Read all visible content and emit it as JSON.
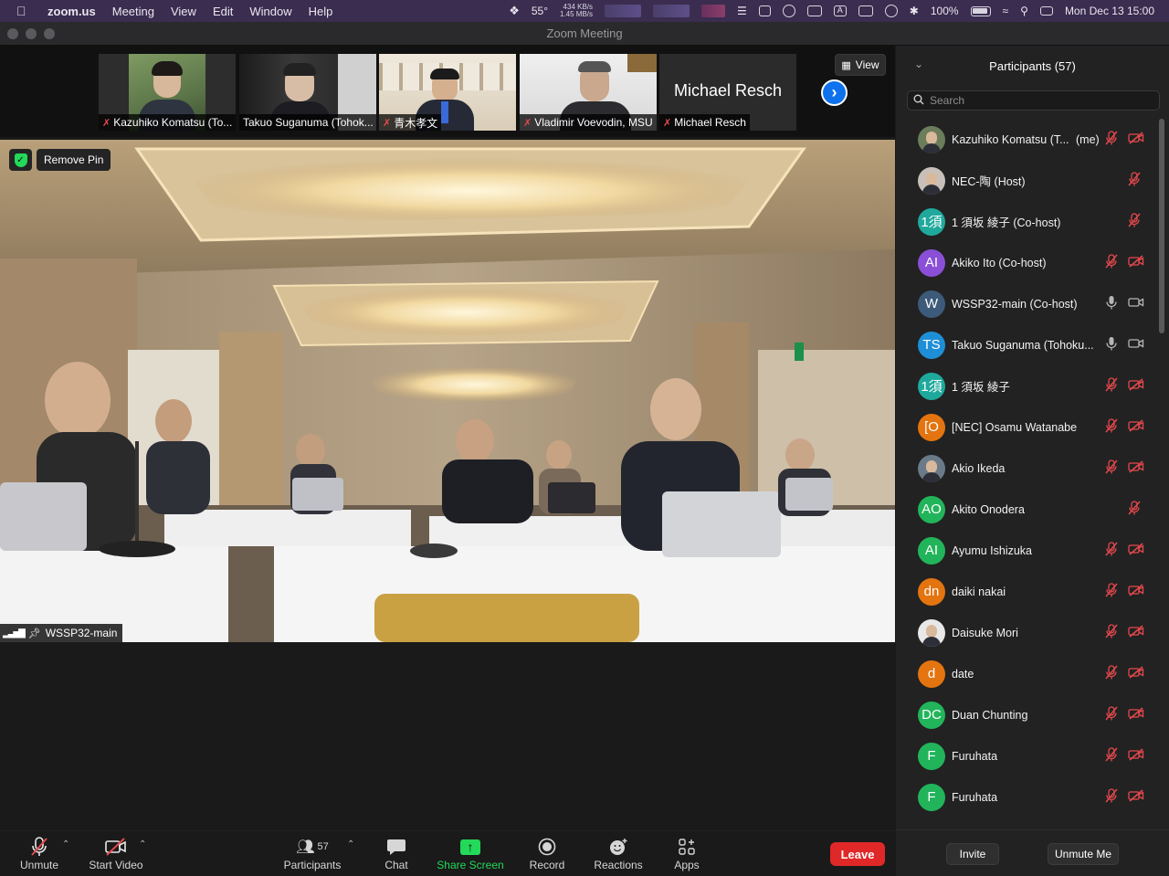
{
  "menubar": {
    "app": "zoom.us",
    "items": [
      "Meeting",
      "View",
      "Edit",
      "Window",
      "Help"
    ],
    "temperature": "55°",
    "net_up": "434 KB/s",
    "net_down": "1.45 MB/s",
    "battery": "100%",
    "datetime": "Mon Dec 13  15:00"
  },
  "window": {
    "title": "Zoom Meeting"
  },
  "gallery": {
    "tiles": [
      {
        "name": "Kazuhiko Komatsu (To...",
        "muted": true
      },
      {
        "name": "Takuo Suganuma (Tohok...",
        "muted": false
      },
      {
        "name": "青木孝文",
        "muted": true
      },
      {
        "name": "Vladimir Voevodin, MSU",
        "muted": true
      },
      {
        "name": "Michael Resch",
        "muted": true,
        "display": "Michael Resch"
      }
    ],
    "view_label": "View"
  },
  "main_video": {
    "remove_pin_label": "Remove Pin",
    "speaker_label": "WSSP32-main"
  },
  "toolbar": {
    "unmute": "Unmute",
    "start_video": "Start Video",
    "participants": "Participants",
    "participants_count": "57",
    "chat": "Chat",
    "share_screen": "Share Screen",
    "record": "Record",
    "reactions": "Reactions",
    "apps": "Apps",
    "leave": "Leave"
  },
  "panel": {
    "title": "Participants (57)",
    "search_placeholder": "Search",
    "invite": "Invite",
    "unmute_me": "Unmute Me",
    "participants": [
      {
        "name": "Kazuhiko Komatsu (T...",
        "suffix": "(me)",
        "avatar": "photo",
        "color": "#6b7d5a",
        "mic": "muted",
        "cam": "off"
      },
      {
        "name": "NEC-陶 (Host)",
        "avatar": "photo",
        "color": "#c8c0b8",
        "mic": "muted",
        "cam": "none"
      },
      {
        "name": "1 須坂 綾子 (Co-host)",
        "avatar": "1須",
        "color": "#1fa99c",
        "mic": "muted",
        "cam": "none"
      },
      {
        "name": "Akiko Ito (Co-host)",
        "avatar": "AI",
        "color": "#8a4fd6",
        "mic": "muted",
        "cam": "off"
      },
      {
        "name": "WSSP32-main (Co-host)",
        "avatar": "W",
        "color": "#3d5a7a",
        "mic": "on",
        "cam": "on"
      },
      {
        "name": "Takuo Suganuma (Tohoku...",
        "avatar": "TS",
        "color": "#1e8fd6",
        "mic": "on",
        "cam": "on"
      },
      {
        "name": "1 須坂 綾子",
        "avatar": "1須",
        "color": "#1fa99c",
        "mic": "muted",
        "cam": "off"
      },
      {
        "name": "[NEC] Osamu Watanabe",
        "avatar": "[O",
        "color": "#e3740f",
        "mic": "muted",
        "cam": "off"
      },
      {
        "name": "Akio Ikeda",
        "avatar": "photo",
        "color": "#6a7a88",
        "mic": "muted",
        "cam": "off"
      },
      {
        "name": "Akito Onodera",
        "avatar": "AO",
        "color": "#22b45a",
        "mic": "muted",
        "cam": "none"
      },
      {
        "name": "Ayumu Ishizuka",
        "avatar": "AI",
        "color": "#22b45a",
        "mic": "muted",
        "cam": "off"
      },
      {
        "name": "daiki nakai",
        "avatar": "dn",
        "color": "#e3740f",
        "mic": "muted",
        "cam": "off"
      },
      {
        "name": "Daisuke Mori",
        "avatar": "photo",
        "color": "#e8e8e8",
        "mic": "muted",
        "cam": "off"
      },
      {
        "name": "date",
        "avatar": "d",
        "color": "#e3740f",
        "mic": "muted",
        "cam": "off"
      },
      {
        "name": "Duan Chunting",
        "avatar": "DC",
        "color": "#22b45a",
        "mic": "muted",
        "cam": "off"
      },
      {
        "name": "Furuhata",
        "avatar": "F",
        "color": "#22b45a",
        "mic": "muted",
        "cam": "off"
      },
      {
        "name": "Furuhata",
        "avatar": "F",
        "color": "#22b45a",
        "mic": "muted",
        "cam": "off"
      }
    ]
  }
}
